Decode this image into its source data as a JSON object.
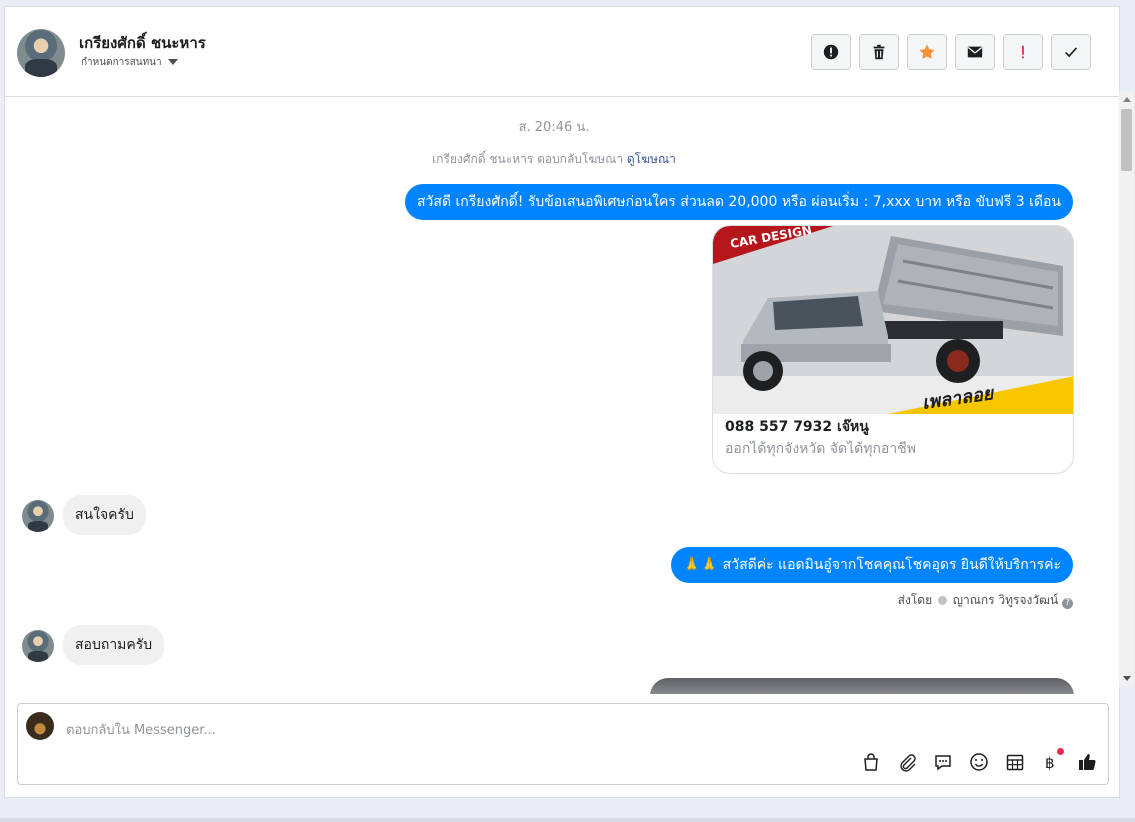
{
  "header": {
    "name": "เกรียงศักดิ์ ชนะหาร",
    "assign_label": "กำหนดการสนทนา",
    "actions": [
      {
        "name": "spam-button",
        "icon": "alert-circle-icon"
      },
      {
        "name": "delete-button",
        "icon": "trash-icon"
      },
      {
        "name": "star-button",
        "icon": "star-icon",
        "color": "#f7923b"
      },
      {
        "name": "mark-unread-button",
        "icon": "mail-icon"
      },
      {
        "name": "follow-up-button",
        "icon": "exclamation-icon",
        "color": "#f02849"
      },
      {
        "name": "mark-done-button",
        "icon": "check-icon"
      }
    ]
  },
  "conversation": {
    "timestamp": "ส. 20:46 น.",
    "system_message": "เกรียงศักดิ์ ชนะหาร ตอบกลับโฆษณา",
    "system_link": "ดูโฆษณา",
    "messages": [
      {
        "side": "out",
        "text": "สวัสดี เกรียงศักดิ์! รับข้อเสนอพิเศษก่อนใคร ส่วนลด 20,000 หรือ ผ่อนเริ่ม : 7,xxx บาท หรือ ขับฟรี 3 เดือน"
      },
      {
        "side": "in",
        "text": "สนใจครับ"
      },
      {
        "side": "out",
        "text": "🙏🙏 สวัสดีค่ะ แอดมินอู๋จากโชคคุณโชคอุดร ยินดีให้บริการค่ะ"
      },
      {
        "side": "in",
        "text": "สอบถามครับ"
      }
    ],
    "card": {
      "image_caption": "CAR DESIGN",
      "image_banner": "เพลาลอย",
      "title": "088 557 7932 เจ๊หนู",
      "subtitle": "ออกได้ทุกจังหวัด จัดได้ทุกอาชีพ"
    },
    "sent_by": {
      "prefix": "ส่งโดย",
      "name": "ญาณกร วิทูรจงวัฒน์"
    }
  },
  "composer": {
    "placeholder": "ตอบกลับใน Messenger...",
    "tools": [
      "shopping-bag-icon",
      "paperclip-icon",
      "saved-reply-icon",
      "emoji-icon",
      "calendar-icon",
      "baht-payment-icon",
      "thumbs-up-icon"
    ]
  },
  "colors": {
    "outgoing_bubble": "#0084ff",
    "incoming_bubble": "#f1f0f0",
    "link": "#385898"
  }
}
